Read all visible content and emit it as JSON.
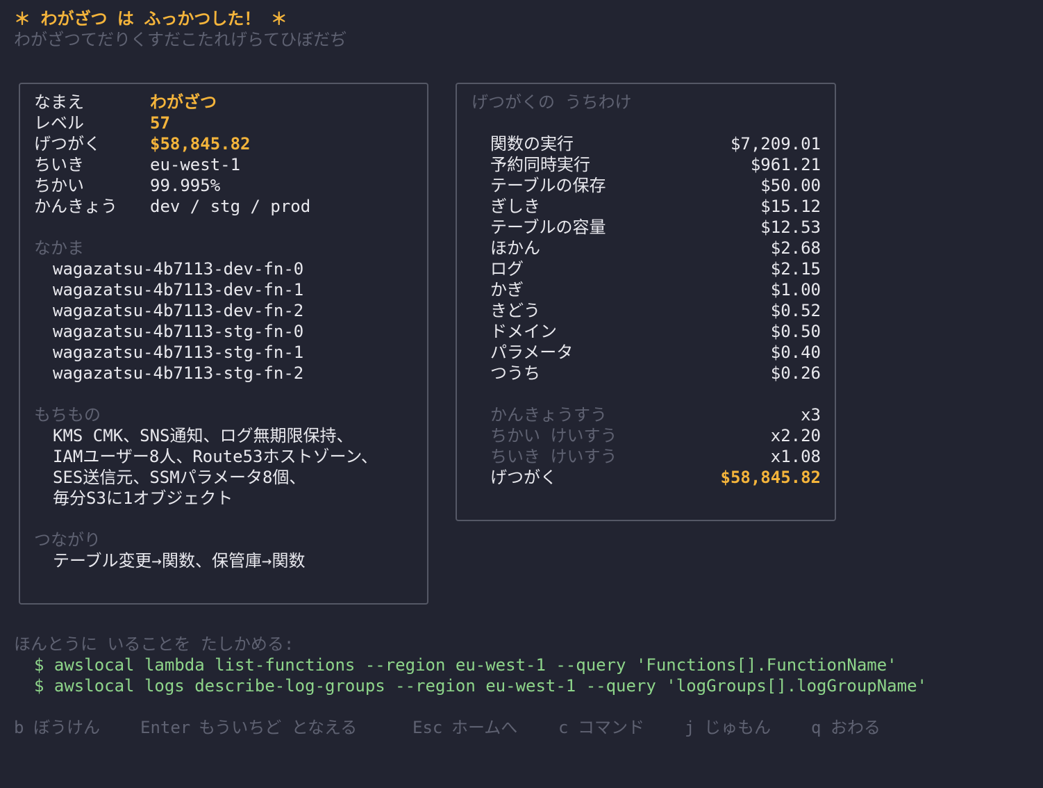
{
  "header": {
    "title": "＊ わがざつ は ふっかつした！ ＊",
    "subtitle": "わがざつてだりくすだこたれげらてひぼだぢ"
  },
  "status": {
    "rows": [
      {
        "label": "なまえ",
        "value": "わがざつ"
      },
      {
        "label": "レベル",
        "value": "57"
      },
      {
        "label": "げつがく",
        "value": "$58,845.82"
      },
      {
        "label": "ちいき",
        "value": "eu-west-1"
      },
      {
        "label": "ちかい",
        "value": "99.995%"
      },
      {
        "label": "かんきょう",
        "value": "dev / stg / prod"
      }
    ],
    "party_heading": "なかま",
    "party": [
      "wagazatsu-4b7113-dev-fn-0",
      "wagazatsu-4b7113-dev-fn-1",
      "wagazatsu-4b7113-dev-fn-2",
      "wagazatsu-4b7113-stg-fn-0",
      "wagazatsu-4b7113-stg-fn-1",
      "wagazatsu-4b7113-stg-fn-2"
    ],
    "items_heading": "もちもの",
    "items": [
      "KMS CMK、SNS通知、ログ無期限保持、",
      "IAMユーザー8人、Route53ホストゾーン、",
      "SES送信元、SSMパラメータ8個、",
      "毎分S3に1オブジェクト"
    ],
    "links_heading": "つながり",
    "links": "テーブル変更→関数、保管庫→関数"
  },
  "breakdown": {
    "heading": "げつがくの うちわけ",
    "rows": [
      {
        "label": "関数の実行",
        "value": "$7,209.01"
      },
      {
        "label": "予約同時実行",
        "value": "$961.21"
      },
      {
        "label": "テーブルの保存",
        "value": "$50.00"
      },
      {
        "label": "ぎしき",
        "value": "$15.12"
      },
      {
        "label": "テーブルの容量",
        "value": "$12.53"
      },
      {
        "label": "ほかん",
        "value": "$2.68"
      },
      {
        "label": "ログ",
        "value": "$2.15"
      },
      {
        "label": "かぎ",
        "value": "$1.00"
      },
      {
        "label": "きどう",
        "value": "$0.52"
      },
      {
        "label": "ドメイン",
        "value": "$0.50"
      },
      {
        "label": "パラメータ",
        "value": "$0.40"
      },
      {
        "label": "つうち",
        "value": "$0.26"
      }
    ],
    "multipliers": [
      {
        "label": "かんきょうすう",
        "value": "x3"
      },
      {
        "label": "ちかい けいすう",
        "value": "x2.20"
      },
      {
        "label": "ちいき けいすう",
        "value": "x1.08"
      }
    ],
    "total_label": "げつがく",
    "total_value": "$58,845.82"
  },
  "verify": {
    "heading": "ほんとうに いることを たしかめる:",
    "commands": [
      "$ awslocal lambda list-functions --region eu-west-1 --query 'Functions[].FunctionName'",
      "$ awslocal logs describe-log-groups --region eu-west-1 --query 'logGroups[].logGroupName'"
    ]
  },
  "footer": {
    "keys": [
      {
        "key": "b",
        "label": "ぼうけん"
      },
      {
        "key": "Enter",
        "label": "もういちど となえる"
      },
      {
        "key": "Esc",
        "label": "ホームへ"
      },
      {
        "key": "c",
        "label": "コマンド"
      },
      {
        "key": "j",
        "label": "じゅもん"
      },
      {
        "key": "q",
        "label": "おわる"
      }
    ]
  }
}
